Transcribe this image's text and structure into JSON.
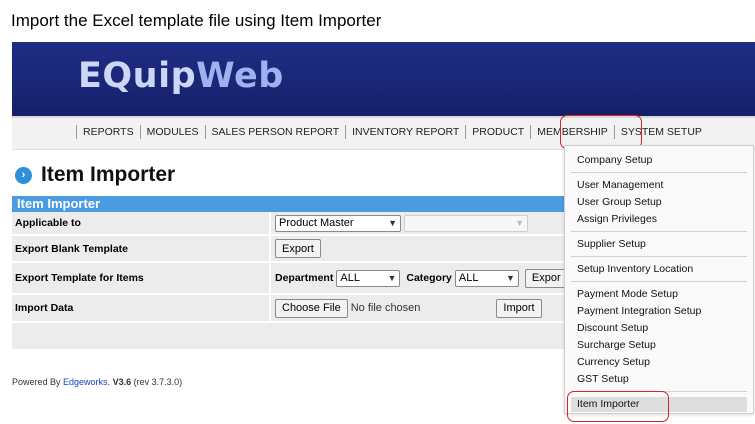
{
  "caption": "Import the Excel template file using Item Importer",
  "brand": {
    "eq": "EQuip",
    "web": "Web"
  },
  "nav": [
    "REPORTS",
    "MODULES",
    "SALES PERSON REPORT",
    "INVENTORY REPORT",
    "PRODUCT",
    "MEMBERSHIP",
    "SYSTEM SETUP"
  ],
  "page": {
    "title": "Item Importer",
    "panel_title": "Item Importer"
  },
  "form": {
    "applicable_label": "Applicable to",
    "applicable_value": "Product Master",
    "export_blank_label": "Export Blank Template",
    "export_button": "Export",
    "export_items_label": "Export Template for Items",
    "department_label": "Department",
    "department_value": "ALL",
    "category_label": "Category",
    "category_value": "ALL",
    "export_items_button": "Expor",
    "import_label": "Import Data",
    "choose_file": "Choose File",
    "no_file": "No file chosen",
    "import_button": "Import"
  },
  "footer": {
    "prefix": "Powered By ",
    "company": "Edgeworks",
    "dot": ". ",
    "version": "V3.6",
    "rev": " (rev 3.7.3.0)"
  },
  "dropdown": {
    "company_setup": "Company Setup",
    "user_management": "User Management",
    "user_group_setup": "User Group Setup",
    "assign_privileges": "Assign Privileges",
    "supplier_setup": "Supplier Setup",
    "setup_inventory_location": "Setup Inventory Location",
    "payment_mode_setup": "Payment Mode Setup",
    "payment_integration_setup": "Payment Integration Setup",
    "discount_setup": "Discount Setup",
    "surcharge_setup": "Surcharge Setup",
    "currency_setup": "Currency Setup",
    "gst_setup": "GST Setup",
    "item_importer": "Item Importer"
  },
  "colors": {
    "highlight": "#d8232a",
    "banner": "#1f2c83",
    "panel_header": "#4a9be1",
    "link": "#1a3fc1"
  },
  "icons": {
    "title_bullet": "chevron-right-circle-icon"
  }
}
